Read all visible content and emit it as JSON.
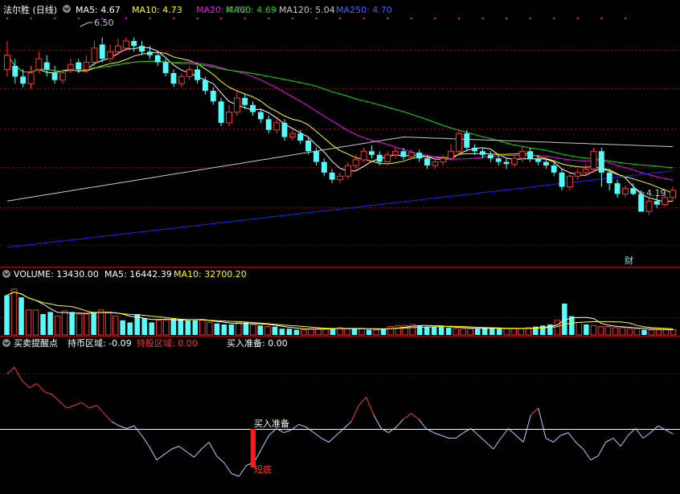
{
  "header": {
    "title": "法尔胜 (日线)",
    "ma5_label": "MA5: 4.67",
    "ma10_label": "MA10: 4.73",
    "ma20_label": "MA20: 4.72",
    "ma60_label": "MA60: 4.69",
    "ma120_label": "MA120: 5.04",
    "ma250_label": "MA250: 4.70"
  },
  "volume_header": {
    "volume_label": "VOLUME: 13430.00",
    "ma5_label": "MA5: 16442.39",
    "ma10_label": "MA10: 32700.20"
  },
  "indicator_header": {
    "name": "买卖提醒点",
    "hold_coin_label": "持币区域: -0.09",
    "hold_stock_label": "持股区域: 0.00",
    "buy_prepare_label": "买入准备: 0.00"
  },
  "annotations": {
    "high_label": "6.50",
    "low_label": "4.19",
    "finance_badge": "财",
    "buy_prepare_text": "买入准备",
    "bottom_text": "短底"
  },
  "colors": {
    "up": "#ff3232",
    "down": "#54fcfc",
    "ma5": "#ffffff",
    "ma10": "#ffff00",
    "ma20": "#ff00ff",
    "ma60": "#00e600",
    "ma120": "#c8c8c8",
    "ma250": "#2020ff",
    "grid": "#8b0000",
    "indicator": "#c0c8ff",
    "indicator_high": "#ff3232"
  },
  "chart_data": [
    {
      "type": "candlestick",
      "title": "法尔胜 (日线)",
      "ylim": [
        3.3,
        6.8
      ],
      "marked_high": 6.5,
      "marked_low": 4.19,
      "series": [
        {
          "name": "MA5",
          "value_last": 4.67
        },
        {
          "name": "MA10",
          "value_last": 4.73
        },
        {
          "name": "MA20",
          "value_last": 4.72
        },
        {
          "name": "MA60",
          "value_last": 4.69
        },
        {
          "name": "MA120",
          "value_last": 5.04
        },
        {
          "name": "MA250",
          "value_last": 4.7
        }
      ],
      "candles": [
        [
          6.05,
          6.25,
          6.45,
          5.95
        ],
        [
          6.1,
          5.95,
          6.2,
          5.85
        ],
        [
          5.95,
          5.85,
          6.05,
          5.8
        ],
        [
          5.85,
          6.0,
          6.1,
          5.78
        ],
        [
          6.05,
          6.2,
          6.3,
          6.0
        ],
        [
          6.15,
          6.05,
          6.25,
          5.95
        ],
        [
          6.0,
          5.9,
          6.1,
          5.85
        ],
        [
          5.9,
          6.0,
          6.05,
          5.85
        ],
        [
          6.05,
          6.12,
          6.2,
          6.0
        ],
        [
          6.15,
          6.05,
          6.2,
          6.0
        ],
        [
          6.05,
          6.15,
          6.25,
          6.0
        ],
        [
          6.15,
          6.35,
          6.45,
          6.1
        ],
        [
          6.4,
          6.2,
          6.5,
          6.15
        ],
        [
          6.2,
          6.3,
          6.4,
          6.15
        ],
        [
          6.3,
          6.38,
          6.48,
          6.25
        ],
        [
          6.35,
          6.45,
          6.5,
          6.3
        ],
        [
          6.45,
          6.38,
          6.5,
          6.3
        ],
        [
          6.38,
          6.3,
          6.45,
          6.25
        ],
        [
          6.3,
          6.25,
          6.38,
          6.2
        ],
        [
          6.25,
          6.15,
          6.3,
          6.1
        ],
        [
          6.15,
          6.0,
          6.2,
          5.95
        ],
        [
          6.0,
          5.85,
          6.05,
          5.8
        ],
        [
          5.85,
          5.95,
          6.0,
          5.8
        ],
        [
          5.95,
          6.05,
          6.1,
          5.9
        ],
        [
          6.05,
          5.9,
          6.1,
          5.85
        ],
        [
          5.9,
          5.75,
          5.95,
          5.7
        ],
        [
          5.75,
          5.6,
          5.8,
          5.55
        ],
        [
          5.6,
          5.3,
          5.65,
          5.25
        ],
        [
          5.3,
          5.45,
          5.55,
          5.25
        ],
        [
          5.45,
          5.65,
          5.75,
          5.4
        ],
        [
          5.65,
          5.55,
          5.7,
          5.5
        ],
        [
          5.55,
          5.45,
          5.6,
          5.4
        ],
        [
          5.45,
          5.35,
          5.5,
          5.3
        ],
        [
          5.35,
          5.2,
          5.4,
          5.15
        ],
        [
          5.2,
          5.3,
          5.35,
          5.15
        ],
        [
          5.3,
          5.1,
          5.35,
          5.05
        ],
        [
          5.1,
          5.15,
          5.2,
          5.05
        ],
        [
          5.15,
          5.05,
          5.2,
          5.0
        ],
        [
          5.05,
          4.9,
          5.1,
          4.85
        ],
        [
          4.9,
          4.75,
          4.95,
          4.7
        ],
        [
          4.75,
          4.6,
          4.8,
          4.55
        ],
        [
          4.6,
          4.5,
          4.65,
          4.45
        ],
        [
          4.5,
          4.55,
          4.6,
          4.45
        ],
        [
          4.55,
          4.7,
          4.75,
          4.5
        ],
        [
          4.7,
          4.78,
          4.85,
          4.65
        ],
        [
          4.78,
          4.9,
          4.95,
          4.75
        ],
        [
          4.9,
          4.85,
          4.98,
          4.8
        ],
        [
          4.85,
          4.75,
          4.9,
          4.7
        ],
        [
          4.75,
          4.85,
          4.9,
          4.72
        ],
        [
          4.85,
          4.9,
          4.95,
          4.8
        ],
        [
          4.9,
          4.82,
          4.95,
          4.78
        ],
        [
          4.82,
          4.88,
          4.92,
          4.78
        ],
        [
          4.88,
          4.8,
          4.92,
          4.75
        ],
        [
          4.8,
          4.7,
          4.85,
          4.65
        ],
        [
          4.7,
          4.75,
          4.8,
          4.65
        ],
        [
          4.75,
          4.8,
          4.85,
          4.7
        ],
        [
          4.8,
          4.9,
          5.0,
          4.78
        ],
        [
          4.9,
          5.15,
          5.2,
          4.85
        ],
        [
          5.15,
          4.95,
          5.2,
          4.9
        ],
        [
          4.95,
          4.9,
          5.0,
          4.85
        ],
        [
          4.9,
          4.85,
          4.95,
          4.8
        ],
        [
          4.85,
          4.8,
          4.9,
          4.75
        ],
        [
          4.8,
          4.75,
          4.85,
          4.7
        ],
        [
          4.75,
          4.72,
          4.8,
          4.65
        ],
        [
          4.72,
          4.8,
          4.85,
          4.68
        ],
        [
          4.8,
          4.9,
          4.95,
          4.75
        ],
        [
          4.9,
          4.8,
          4.95,
          4.75
        ],
        [
          4.8,
          4.75,
          4.85,
          4.7
        ],
        [
          4.75,
          4.7,
          4.8,
          4.65
        ],
        [
          4.7,
          4.6,
          4.75,
          4.55
        ],
        [
          4.6,
          4.4,
          4.65,
          4.35
        ],
        [
          4.4,
          4.55,
          4.6,
          4.35
        ],
        [
          4.55,
          4.6,
          4.65,
          4.5
        ],
        [
          4.6,
          4.65,
          4.72,
          4.55
        ],
        [
          4.65,
          4.9,
          4.95,
          4.6
        ],
        [
          4.9,
          4.6,
          4.95,
          4.4
        ],
        [
          4.6,
          4.45,
          4.65,
          4.35
        ],
        [
          4.45,
          4.3,
          4.5,
          4.25
        ],
        [
          4.3,
          4.38,
          4.42,
          4.25
        ],
        [
          4.38,
          4.3,
          4.45,
          4.28
        ],
        [
          4.3,
          4.05,
          4.35,
          4.19
        ],
        [
          4.05,
          4.2,
          4.25,
          4.0
        ],
        [
          4.2,
          4.15,
          4.28,
          4.1
        ],
        [
          4.15,
          4.25,
          4.3,
          4.12
        ],
        [
          4.25,
          4.35,
          4.4,
          4.2
        ]
      ]
    },
    {
      "type": "bar",
      "title": "VOLUME",
      "ylim": [
        0,
        50
      ],
      "values": [
        38,
        44,
        36,
        24,
        24,
        20,
        22,
        18,
        23,
        22,
        20,
        20,
        22,
        24,
        22,
        18,
        14,
        12,
        20,
        16,
        12,
        14,
        14,
        16,
        15,
        14,
        14,
        14,
        12,
        11,
        10,
        10,
        12,
        12,
        10,
        9,
        8,
        8,
        6,
        6,
        5,
        5,
        6,
        6,
        6,
        6,
        7,
        6,
        6,
        6,
        5,
        5,
        6,
        8,
        9,
        9,
        10,
        9,
        8,
        8,
        8,
        7,
        6,
        6,
        6,
        6,
        7,
        7,
        6,
        6,
        6,
        6,
        7,
        8,
        9,
        10,
        14,
        30,
        18,
        12,
        10,
        9,
        8,
        8,
        7,
        7,
        6,
        6,
        5,
        5,
        5,
        5,
        5
      ],
      "up": [
        0,
        1,
        0,
        1,
        1,
        0,
        0,
        1,
        1,
        0,
        1,
        1,
        0,
        1,
        1,
        1,
        0,
        0,
        0,
        0,
        0,
        1,
        1,
        0,
        0,
        0,
        0,
        1,
        1,
        0,
        0,
        0,
        1,
        0,
        1,
        0,
        1,
        0,
        0,
        0,
        0,
        1,
        1,
        1,
        1,
        0,
        1,
        1,
        0,
        1,
        0,
        1,
        0,
        1,
        1,
        1,
        1,
        0,
        0,
        0,
        0,
        0,
        1,
        1,
        1,
        0,
        0,
        0,
        0,
        1,
        1,
        1,
        1,
        0,
        0,
        0,
        1,
        0,
        0,
        1,
        0,
        1,
        1,
        1,
        1,
        1,
        1,
        1,
        0,
        1,
        1,
        1,
        1
      ]
    },
    {
      "type": "line",
      "title": "买卖提醒点",
      "ylim": [
        -0.5,
        0.5
      ],
      "series": [
        {
          "name": "持币区域",
          "value_last": -0.09
        },
        {
          "name": "持股区域",
          "value_last": 0.0
        },
        {
          "name": "买入准备",
          "value_last": 0.0
        }
      ],
      "values": [
        0.35,
        0.4,
        0.3,
        0.25,
        0.28,
        0.22,
        0.2,
        0.15,
        0.1,
        0.12,
        0.14,
        0.1,
        0.12,
        0.06,
        0.0,
        -0.03,
        -0.05,
        -0.03,
        -0.1,
        -0.18,
        -0.28,
        -0.24,
        -0.2,
        -0.18,
        -0.22,
        -0.26,
        -0.2,
        -0.15,
        -0.25,
        -0.3,
        -0.38,
        -0.4,
        -0.32,
        -0.3,
        -0.2,
        -0.1,
        -0.05,
        -0.08,
        -0.06,
        -0.02,
        -0.04,
        -0.08,
        -0.12,
        -0.15,
        -0.1,
        -0.05,
        0.0,
        0.12,
        0.18,
        0.05,
        -0.05,
        -0.08,
        -0.04,
        0.02,
        0.06,
        0.02,
        -0.05,
        -0.08,
        -0.1,
        -0.12,
        -0.12,
        -0.08,
        -0.05,
        -0.1,
        -0.15,
        -0.2,
        -0.12,
        -0.05,
        -0.1,
        -0.15,
        0.05,
        0.1,
        -0.12,
        -0.15,
        -0.1,
        -0.08,
        -0.15,
        -0.2,
        -0.28,
        -0.25,
        -0.15,
        -0.12,
        -0.18,
        -0.1,
        -0.05,
        -0.12,
        -0.08,
        -0.03,
        -0.06,
        -0.09
      ],
      "signal_threshold": 0.0
    }
  ]
}
